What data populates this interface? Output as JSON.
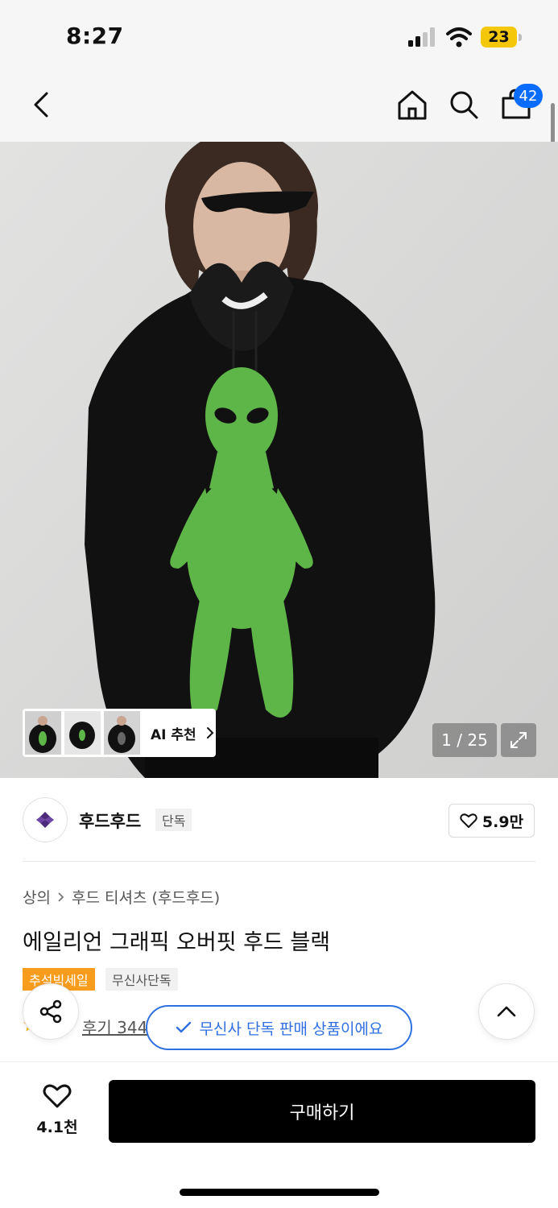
{
  "status_bar": {
    "time": "8:27",
    "battery_level": "23"
  },
  "nav": {
    "back_icon": "chevron-left-icon",
    "home_icon": "home-icon",
    "search_icon": "search-icon",
    "cart_icon": "shopping-bag-icon",
    "cart_count": "42"
  },
  "gallery": {
    "ai_label": "AI 추천",
    "page_indicator": "1 / 25",
    "expand_icon": "expand-icon",
    "thumbnails": [
      "thumbnail-1",
      "thumbnail-2",
      "thumbnail-3"
    ]
  },
  "brand": {
    "name": "후드후드",
    "tag": "단독",
    "likes": "5.9만"
  },
  "product": {
    "breadcrumb": [
      "상의",
      "후드 티셔츠 (후드후드)"
    ],
    "title": "에일리언 그래픽 오버핏 후드 블랙",
    "tags": [
      "추석빅세일",
      "무신사단독"
    ],
    "review_link": "후기 344"
  },
  "toast": {
    "text": "무신사 단독 판매 상품이에요"
  },
  "bottom_bar": {
    "wish_count": "4.1천",
    "buy_label": "구매하기"
  },
  "colors": {
    "accent_blue": "#2f6fe0",
    "badge_blue": "#0a6cff",
    "sale_orange": "#f79c1c",
    "alien_green": "#5eb548"
  }
}
